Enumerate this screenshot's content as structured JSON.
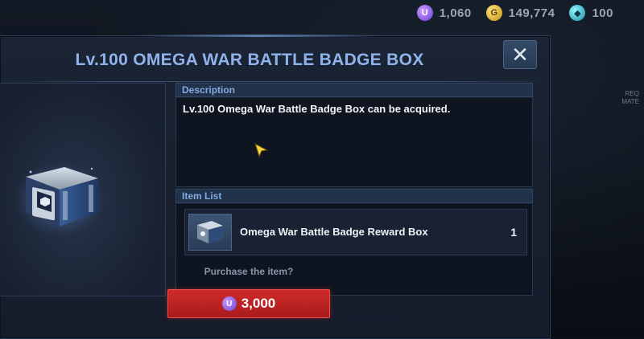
{
  "currencies": [
    {
      "icon": "units-icon",
      "glyph": "U",
      "value": "1,060"
    },
    {
      "icon": "gold-icon",
      "glyph": "G",
      "value": "149,774"
    },
    {
      "icon": "crystal-icon",
      "glyph": "◆",
      "value": "100"
    }
  ],
  "side_label": {
    "line1": "REQ",
    "line2": "MATE"
  },
  "modal": {
    "title": "Lv.100 OMEGA WAR BATTLE BADGE BOX",
    "close_glyph": "✕"
  },
  "description": {
    "header": "Description",
    "text": "Lv.100 Omega War Battle Badge Box can be acquired."
  },
  "item_list": {
    "header": "Item List",
    "items": [
      {
        "name": "Omega War Battle Badge Reward Box",
        "qty": "1"
      }
    ]
  },
  "purchase": {
    "question": "Purchase the item?",
    "currency_glyph": "U",
    "price": "3,000"
  },
  "colors": {
    "title": "#8fb3ea",
    "header": "#7fa9e0",
    "buy_button": "#c02424"
  }
}
